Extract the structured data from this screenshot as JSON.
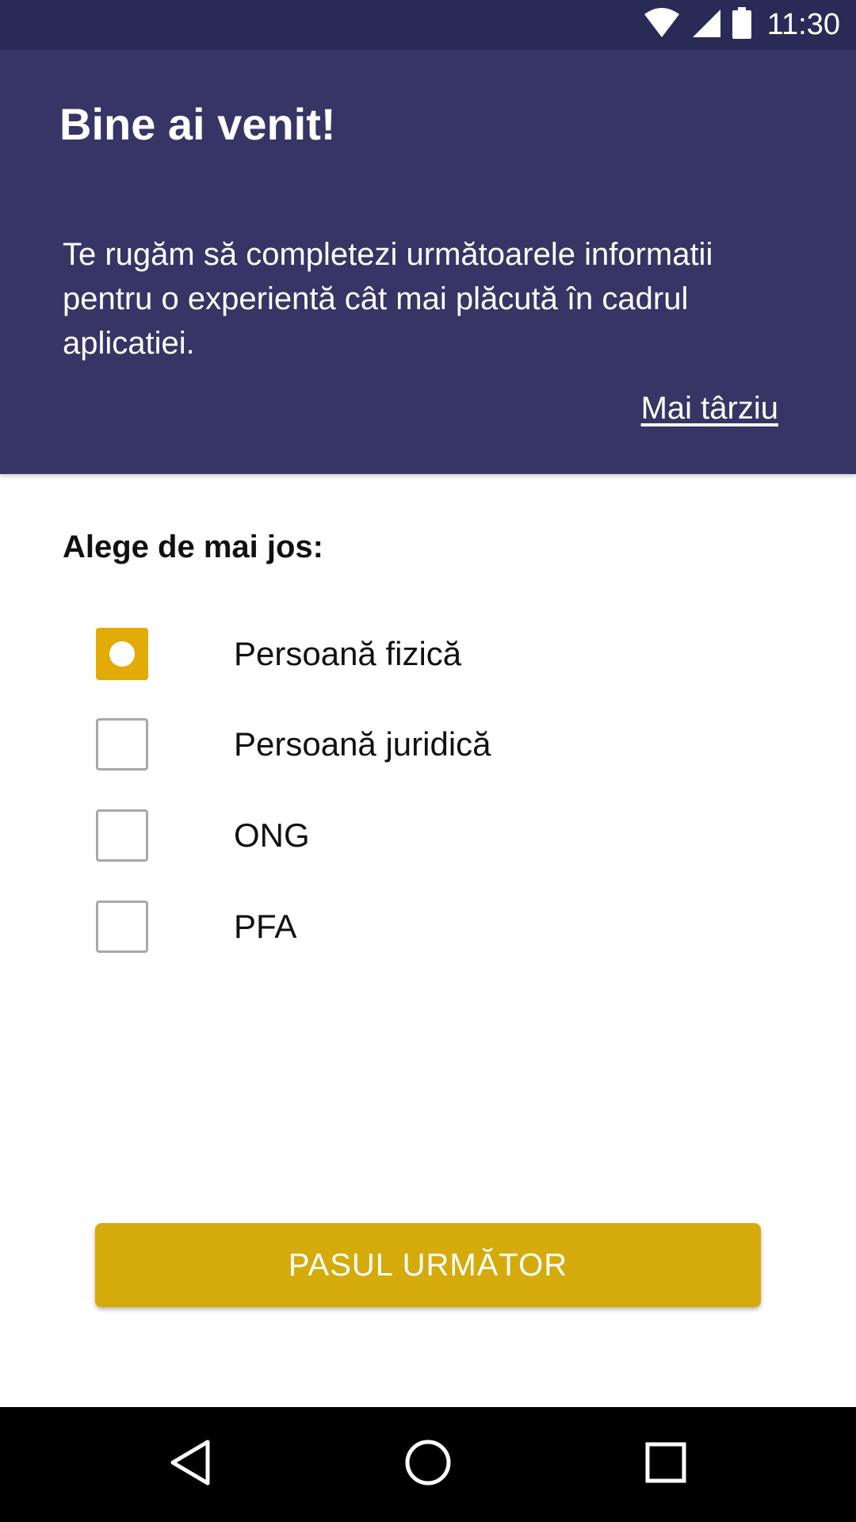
{
  "status_bar": {
    "time": "11:30",
    "icons": [
      "wifi-icon",
      "signal-icon",
      "battery-icon"
    ]
  },
  "header": {
    "title": "Bine ai venit!",
    "message": "Te rugăm să completezi următoarele informatii pentru o experientă cât mai plăcută în cadrul aplicatiei.",
    "later_link": "Mai târziu"
  },
  "form": {
    "prompt": "Alege de mai jos:",
    "options": [
      {
        "label": "Persoană fizică",
        "selected": true
      },
      {
        "label": "Persoană juridică",
        "selected": false
      },
      {
        "label": "ONG",
        "selected": false
      },
      {
        "label": "PFA",
        "selected": false
      }
    ],
    "next_button": "PASUL URMĂTOR"
  },
  "nav_bar": {
    "icons": [
      "back-icon",
      "home-icon",
      "recents-icon"
    ]
  },
  "colors": {
    "status_bar": "#2a2a57",
    "header": "#363566",
    "accent": "#d5ab0b",
    "selected_option": "#e2ab06"
  }
}
